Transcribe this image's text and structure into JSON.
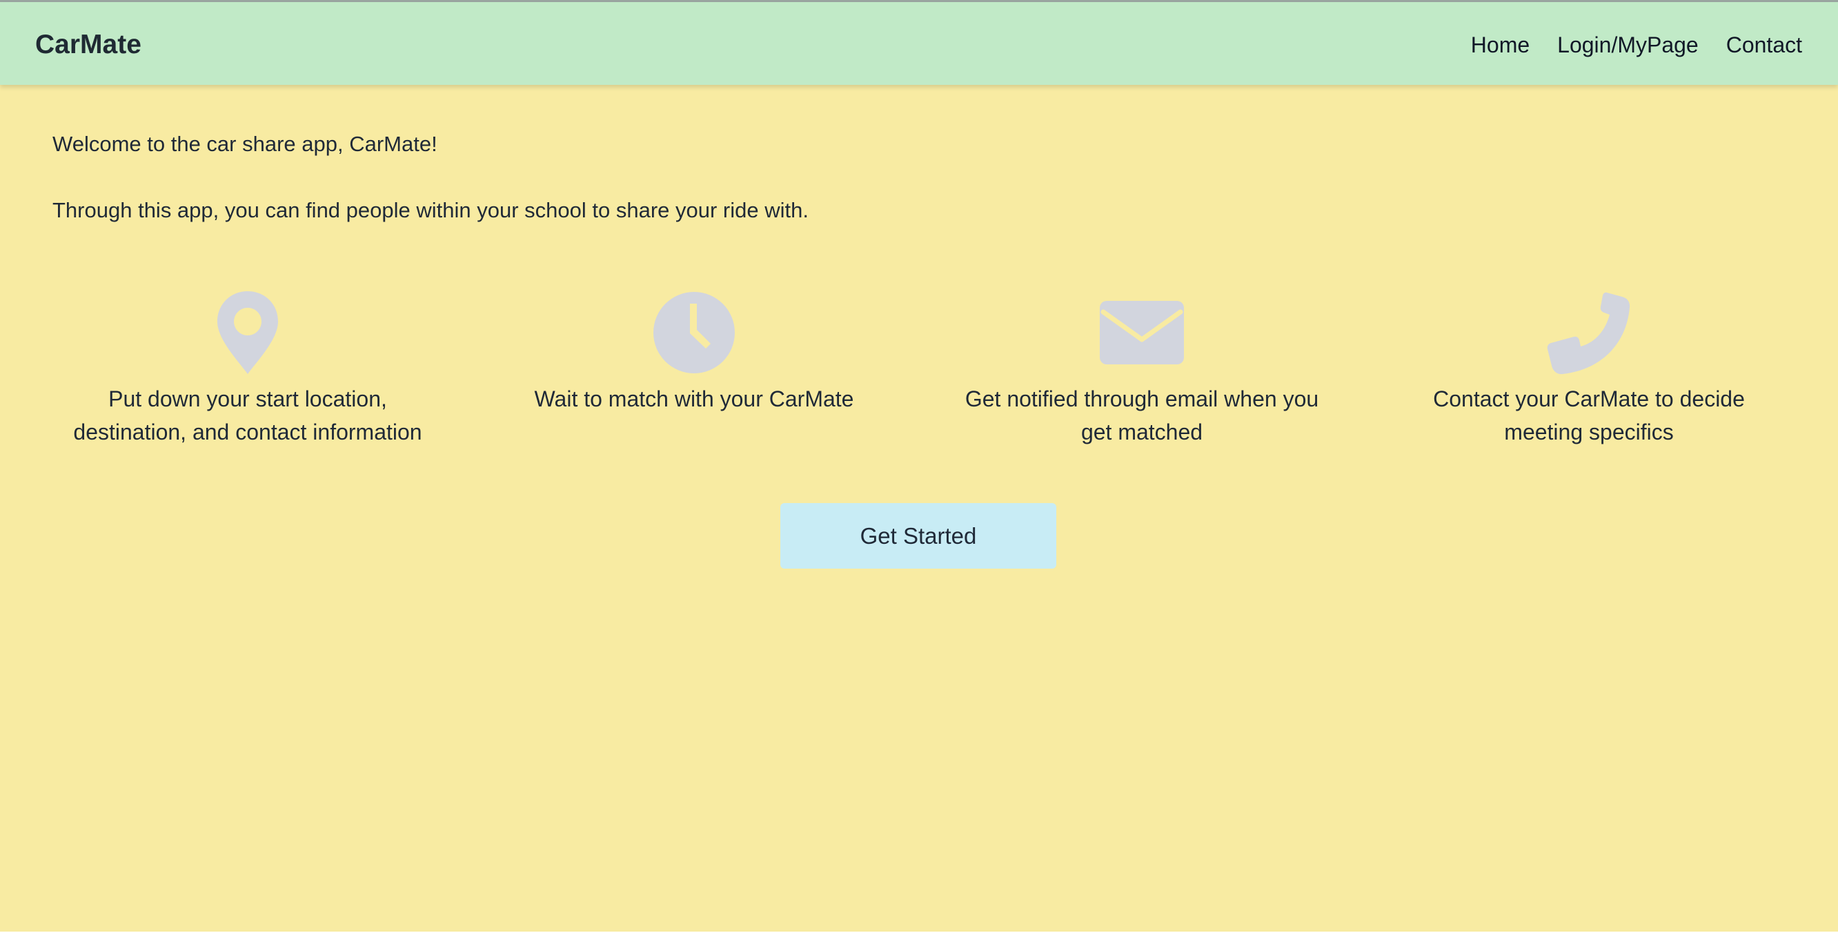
{
  "navbar": {
    "brand": "CarMate",
    "links": [
      "Home",
      "Login/MyPage",
      "Contact"
    ]
  },
  "intro": {
    "welcome": "Welcome to the car share app, CarMate!",
    "description": "Through this app, you can find people within your school to share your ride with."
  },
  "features": [
    {
      "icon": "map-pin-icon",
      "label_line1": "Put down your start location,",
      "label_line2": "destination, and contact information"
    },
    {
      "icon": "clock-icon",
      "label_line1": "Wait to match with your CarMate",
      "label_line2": ""
    },
    {
      "icon": "envelope-icon",
      "label_line1": "Get notified through email when you",
      "label_line2": "get matched"
    },
    {
      "icon": "phone-icon",
      "label_line1": "Contact your CarMate to decide",
      "label_line2": "meeting specifics"
    }
  ],
  "cta": {
    "label": "Get Started"
  },
  "colors": {
    "background": "#f8eba2",
    "navbar": "#c1eac7",
    "button": "#c8ecf5",
    "icon": "#d2d5de"
  }
}
